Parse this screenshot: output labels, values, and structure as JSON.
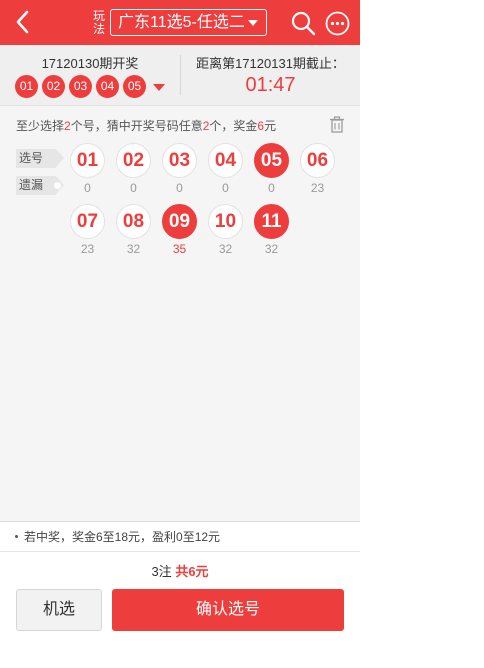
{
  "header": {
    "play_label": "玩法",
    "play_select": "广东11选5-任选二"
  },
  "period": {
    "last_issue": "17120130期开奖",
    "last_numbers": [
      "01",
      "02",
      "03",
      "04",
      "05"
    ],
    "next_label": "距离第17120131期截止：",
    "countdown": "01:47"
  },
  "tip": {
    "part1": "至少选择",
    "n1": "2",
    "part2": "个号，猜中开奖号码任意",
    "n2": "2",
    "part3": "个，奖金",
    "n3": "6",
    "part4": "元"
  },
  "labels": {
    "pick": "选号",
    "omit": "遗漏"
  },
  "numbers": [
    {
      "num": "01",
      "miss": "0",
      "selected": false
    },
    {
      "num": "02",
      "miss": "0",
      "selected": false
    },
    {
      "num": "03",
      "miss": "0",
      "selected": false
    },
    {
      "num": "04",
      "miss": "0",
      "selected": false
    },
    {
      "num": "05",
      "miss": "0",
      "selected": true
    },
    {
      "num": "06",
      "miss": "23",
      "selected": false
    },
    {
      "num": "07",
      "miss": "23",
      "selected": false
    },
    {
      "num": "08",
      "miss": "32",
      "selected": false
    },
    {
      "num": "09",
      "miss": "35",
      "selected": true
    },
    {
      "num": "10",
      "miss": "32",
      "selected": false
    },
    {
      "num": "11",
      "miss": "32",
      "selected": true
    }
  ],
  "prize_info": "若中奖，奖金6至18元，盈利0至12元",
  "summary": {
    "bets": "3注",
    "total": "共6元"
  },
  "buttons": {
    "random": "机选",
    "confirm": "确认选号"
  },
  "colors": {
    "accent": "#ee3d3d"
  }
}
